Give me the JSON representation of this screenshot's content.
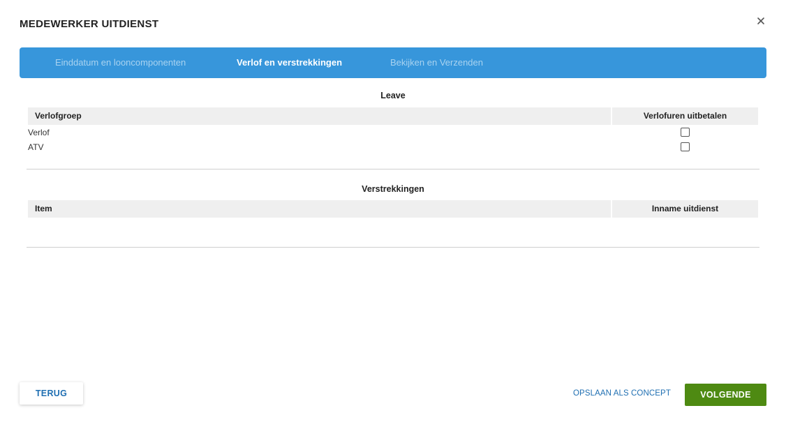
{
  "dialog": {
    "title": "MEDEWERKER UITDIENST",
    "close_icon": "close-icon"
  },
  "stepper": {
    "steps": [
      {
        "label": "Einddatum en looncomponenten",
        "state": "inactive"
      },
      {
        "label": "Verlof en verstrekkingen",
        "state": "active"
      },
      {
        "label": "Bekijken en Verzenden",
        "state": "inactive"
      }
    ]
  },
  "leave_section": {
    "title": "Leave",
    "columns": [
      "Verlofgroep",
      "Verlofuren uitbetalen"
    ],
    "rows": [
      {
        "label": "Verlof",
        "checked": false
      },
      {
        "label": "ATV",
        "checked": false
      }
    ]
  },
  "verstrekkingen_section": {
    "title": "Verstrekkingen",
    "columns": [
      "Item",
      "Inname uitdienst"
    ],
    "rows": []
  },
  "footer": {
    "back_label": "TERUG",
    "save_concept_label": "OPSLAAN ALS CONCEPT",
    "next_label": "VOLGENDE"
  },
  "colors": {
    "stepper_bg": "#3796db",
    "primary_green": "#4e8a12",
    "link_blue": "#1f6fb2"
  }
}
